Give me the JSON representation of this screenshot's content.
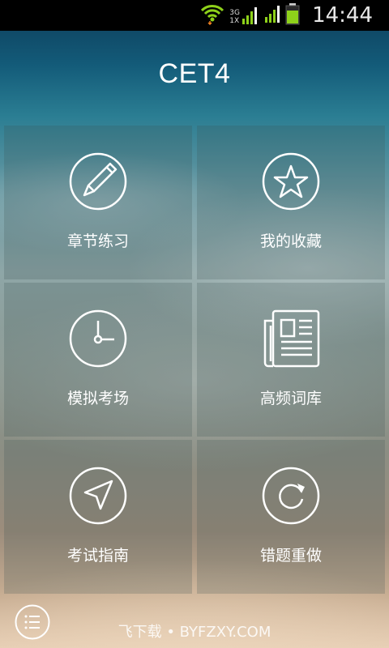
{
  "status_bar": {
    "time": "14:44",
    "network_top": "3G",
    "network_bottom": "1X",
    "icons": [
      "wifi-icon",
      "signal-3g-icon",
      "signal-icon",
      "battery-icon"
    ]
  },
  "app": {
    "title": "CET4"
  },
  "tiles": [
    {
      "label": "章节练习",
      "icon": "pencil-icon"
    },
    {
      "label": "我的收藏",
      "icon": "star-icon"
    },
    {
      "label": "模拟考场",
      "icon": "clock-icon"
    },
    {
      "label": "高频词库",
      "icon": "newspaper-icon"
    },
    {
      "label": "考试指南",
      "icon": "navigation-arrow-icon"
    },
    {
      "label": "错题重做",
      "icon": "refresh-icon"
    }
  ],
  "footer": {
    "watermark": "飞下载 • BYFZXY.COM",
    "menu_icon": "list-menu-icon"
  },
  "colors": {
    "status_bar_bg": "#000000",
    "text": "#ffffff",
    "battery": "#8ed11a",
    "wifi": "#8ed11a"
  }
}
